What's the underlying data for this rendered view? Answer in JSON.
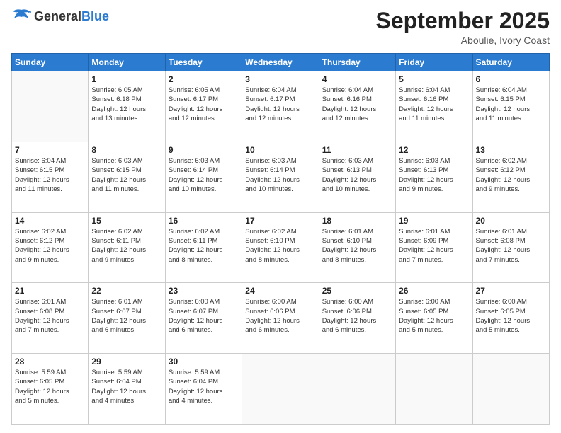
{
  "header": {
    "logo_general": "General",
    "logo_blue": "Blue",
    "month_title": "September 2025",
    "subtitle": "Aboulie, Ivory Coast"
  },
  "weekdays": [
    "Sunday",
    "Monday",
    "Tuesday",
    "Wednesday",
    "Thursday",
    "Friday",
    "Saturday"
  ],
  "weeks": [
    [
      {
        "day": "",
        "sunrise": "",
        "sunset": "",
        "daylight": ""
      },
      {
        "day": "1",
        "sunrise": "Sunrise: 6:05 AM",
        "sunset": "Sunset: 6:18 PM",
        "daylight": "Daylight: 12 hours and 13 minutes."
      },
      {
        "day": "2",
        "sunrise": "Sunrise: 6:05 AM",
        "sunset": "Sunset: 6:17 PM",
        "daylight": "Daylight: 12 hours and 12 minutes."
      },
      {
        "day": "3",
        "sunrise": "Sunrise: 6:04 AM",
        "sunset": "Sunset: 6:17 PM",
        "daylight": "Daylight: 12 hours and 12 minutes."
      },
      {
        "day": "4",
        "sunrise": "Sunrise: 6:04 AM",
        "sunset": "Sunset: 6:16 PM",
        "daylight": "Daylight: 12 hours and 12 minutes."
      },
      {
        "day": "5",
        "sunrise": "Sunrise: 6:04 AM",
        "sunset": "Sunset: 6:16 PM",
        "daylight": "Daylight: 12 hours and 11 minutes."
      },
      {
        "day": "6",
        "sunrise": "Sunrise: 6:04 AM",
        "sunset": "Sunset: 6:15 PM",
        "daylight": "Daylight: 12 hours and 11 minutes."
      }
    ],
    [
      {
        "day": "7",
        "sunrise": "Sunrise: 6:04 AM",
        "sunset": "Sunset: 6:15 PM",
        "daylight": "Daylight: 12 hours and 11 minutes."
      },
      {
        "day": "8",
        "sunrise": "Sunrise: 6:03 AM",
        "sunset": "Sunset: 6:15 PM",
        "daylight": "Daylight: 12 hours and 11 minutes."
      },
      {
        "day": "9",
        "sunrise": "Sunrise: 6:03 AM",
        "sunset": "Sunset: 6:14 PM",
        "daylight": "Daylight: 12 hours and 10 minutes."
      },
      {
        "day": "10",
        "sunrise": "Sunrise: 6:03 AM",
        "sunset": "Sunset: 6:14 PM",
        "daylight": "Daylight: 12 hours and 10 minutes."
      },
      {
        "day": "11",
        "sunrise": "Sunrise: 6:03 AM",
        "sunset": "Sunset: 6:13 PM",
        "daylight": "Daylight: 12 hours and 10 minutes."
      },
      {
        "day": "12",
        "sunrise": "Sunrise: 6:03 AM",
        "sunset": "Sunset: 6:13 PM",
        "daylight": "Daylight: 12 hours and 9 minutes."
      },
      {
        "day": "13",
        "sunrise": "Sunrise: 6:02 AM",
        "sunset": "Sunset: 6:12 PM",
        "daylight": "Daylight: 12 hours and 9 minutes."
      }
    ],
    [
      {
        "day": "14",
        "sunrise": "Sunrise: 6:02 AM",
        "sunset": "Sunset: 6:12 PM",
        "daylight": "Daylight: 12 hours and 9 minutes."
      },
      {
        "day": "15",
        "sunrise": "Sunrise: 6:02 AM",
        "sunset": "Sunset: 6:11 PM",
        "daylight": "Daylight: 12 hours and 9 minutes."
      },
      {
        "day": "16",
        "sunrise": "Sunrise: 6:02 AM",
        "sunset": "Sunset: 6:11 PM",
        "daylight": "Daylight: 12 hours and 8 minutes."
      },
      {
        "day": "17",
        "sunrise": "Sunrise: 6:02 AM",
        "sunset": "Sunset: 6:10 PM",
        "daylight": "Daylight: 12 hours and 8 minutes."
      },
      {
        "day": "18",
        "sunrise": "Sunrise: 6:01 AM",
        "sunset": "Sunset: 6:10 PM",
        "daylight": "Daylight: 12 hours and 8 minutes."
      },
      {
        "day": "19",
        "sunrise": "Sunrise: 6:01 AM",
        "sunset": "Sunset: 6:09 PM",
        "daylight": "Daylight: 12 hours and 7 minutes."
      },
      {
        "day": "20",
        "sunrise": "Sunrise: 6:01 AM",
        "sunset": "Sunset: 6:08 PM",
        "daylight": "Daylight: 12 hours and 7 minutes."
      }
    ],
    [
      {
        "day": "21",
        "sunrise": "Sunrise: 6:01 AM",
        "sunset": "Sunset: 6:08 PM",
        "daylight": "Daylight: 12 hours and 7 minutes."
      },
      {
        "day": "22",
        "sunrise": "Sunrise: 6:01 AM",
        "sunset": "Sunset: 6:07 PM",
        "daylight": "Daylight: 12 hours and 6 minutes."
      },
      {
        "day": "23",
        "sunrise": "Sunrise: 6:00 AM",
        "sunset": "Sunset: 6:07 PM",
        "daylight": "Daylight: 12 hours and 6 minutes."
      },
      {
        "day": "24",
        "sunrise": "Sunrise: 6:00 AM",
        "sunset": "Sunset: 6:06 PM",
        "daylight": "Daylight: 12 hours and 6 minutes."
      },
      {
        "day": "25",
        "sunrise": "Sunrise: 6:00 AM",
        "sunset": "Sunset: 6:06 PM",
        "daylight": "Daylight: 12 hours and 6 minutes."
      },
      {
        "day": "26",
        "sunrise": "Sunrise: 6:00 AM",
        "sunset": "Sunset: 6:05 PM",
        "daylight": "Daylight: 12 hours and 5 minutes."
      },
      {
        "day": "27",
        "sunrise": "Sunrise: 6:00 AM",
        "sunset": "Sunset: 6:05 PM",
        "daylight": "Daylight: 12 hours and 5 minutes."
      }
    ],
    [
      {
        "day": "28",
        "sunrise": "Sunrise: 5:59 AM",
        "sunset": "Sunset: 6:05 PM",
        "daylight": "Daylight: 12 hours and 5 minutes."
      },
      {
        "day": "29",
        "sunrise": "Sunrise: 5:59 AM",
        "sunset": "Sunset: 6:04 PM",
        "daylight": "Daylight: 12 hours and 4 minutes."
      },
      {
        "day": "30",
        "sunrise": "Sunrise: 5:59 AM",
        "sunset": "Sunset: 6:04 PM",
        "daylight": "Daylight: 12 hours and 4 minutes."
      },
      {
        "day": "",
        "sunrise": "",
        "sunset": "",
        "daylight": ""
      },
      {
        "day": "",
        "sunrise": "",
        "sunset": "",
        "daylight": ""
      },
      {
        "day": "",
        "sunrise": "",
        "sunset": "",
        "daylight": ""
      },
      {
        "day": "",
        "sunrise": "",
        "sunset": "",
        "daylight": ""
      }
    ]
  ]
}
